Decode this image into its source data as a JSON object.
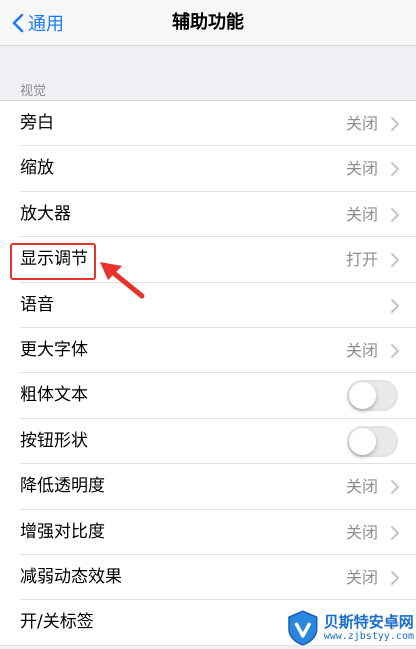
{
  "nav": {
    "back_label": "通用",
    "title": "辅助功能"
  },
  "section": {
    "header": "视觉"
  },
  "rows": [
    {
      "label": "旁白",
      "value": "关闭",
      "control": "chevron"
    },
    {
      "label": "缩放",
      "value": "关闭",
      "control": "chevron"
    },
    {
      "label": "放大器",
      "value": "关闭",
      "control": "chevron"
    },
    {
      "label": "显示调节",
      "value": "打开",
      "control": "chevron"
    },
    {
      "label": "语音",
      "value": "",
      "control": "chevron"
    },
    {
      "label": "更大字体",
      "value": "关闭",
      "control": "chevron"
    },
    {
      "label": "粗体文本",
      "value": "",
      "control": "toggle",
      "on": false
    },
    {
      "label": "按钮形状",
      "value": "",
      "control": "toggle",
      "on": false
    },
    {
      "label": "降低透明度",
      "value": "关闭",
      "control": "chevron"
    },
    {
      "label": "增强对比度",
      "value": "关闭",
      "control": "chevron"
    },
    {
      "label": "减弱动态效果",
      "value": "关闭",
      "control": "chevron"
    },
    {
      "label": "开/关标签",
      "value": "",
      "control": "chevron"
    }
  ],
  "watermark": {
    "title": "贝斯特安卓网",
    "url": "www.zjbstyy.com"
  },
  "colors": {
    "accent": "#1a7cff",
    "highlight": "#e8322c",
    "secondary_text": "#8e8e93"
  }
}
